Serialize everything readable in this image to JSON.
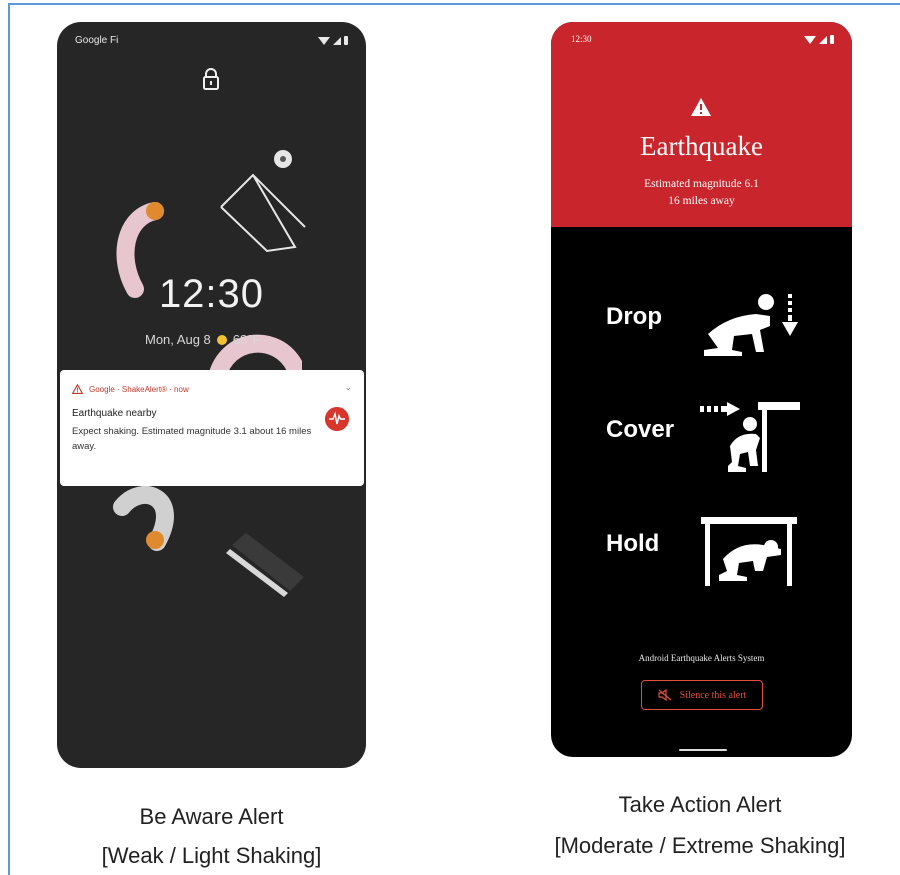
{
  "left_phone": {
    "status_bar": {
      "carrier": "Google Fi"
    },
    "clock": "12:30",
    "date": "Mon, Aug 8",
    "weather_temp": "68°F",
    "notification": {
      "app": "Google · ShakeAlert® · now",
      "title": "Earthquake nearby",
      "body": "Expect shaking. Estimated magnitude 3.1 about 16 miles away."
    },
    "icons": [
      "lock-icon",
      "wifi-icon",
      "cellular-icon",
      "battery-icon",
      "warning-triangle-icon",
      "seismograph-icon",
      "chevron-down-icon",
      "sun-icon"
    ]
  },
  "right_phone": {
    "status_bar": {
      "time": "12:30"
    },
    "title": "Earthquake",
    "magnitude_line": "Estimated magnitude 6.1",
    "distance_line": "16 miles away",
    "actions": [
      {
        "label": "Drop"
      },
      {
        "label": "Cover"
      },
      {
        "label": "Hold"
      }
    ],
    "system_name": "Android Earthquake Alerts System",
    "silence_button": "Silence this alert",
    "colors": {
      "header_red": "#c9252c",
      "button_red": "#e0503d"
    },
    "icons": [
      "warning-icon",
      "mute-icon",
      "drop-pictogram",
      "cover-pictogram",
      "hold-pictogram"
    ]
  },
  "captions": {
    "left_title": "Be Aware Alert",
    "left_subtitle": "[Weak / Light Shaking]",
    "right_title": "Take Action Alert",
    "right_subtitle": "[Moderate / Extreme Shaking]"
  }
}
